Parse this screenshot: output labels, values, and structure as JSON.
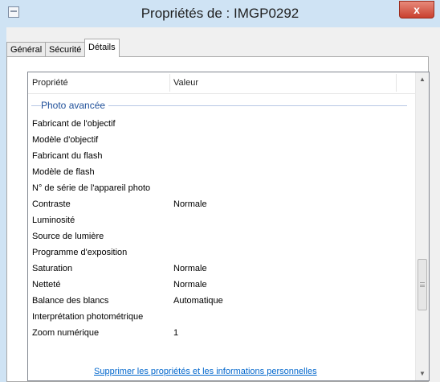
{
  "window": {
    "title": "Propriétés de : IMGP0292",
    "close_glyph": "x"
  },
  "tabs": [
    {
      "label": "Général"
    },
    {
      "label": "Sécurité"
    },
    {
      "label": "Détails"
    }
  ],
  "list": {
    "headers": {
      "property": "Propriété",
      "value": "Valeur"
    },
    "group_label": "Photo avancée",
    "rows": [
      {
        "property": "Fabricant de l'objectif",
        "value": ""
      },
      {
        "property": "Modèle d'objectif",
        "value": ""
      },
      {
        "property": "Fabricant du flash",
        "value": ""
      },
      {
        "property": "Modèle de flash",
        "value": ""
      },
      {
        "property": "N° de série de l'appareil photo",
        "value": ""
      },
      {
        "property": "Contraste",
        "value": "Normale"
      },
      {
        "property": "Luminosité",
        "value": ""
      },
      {
        "property": "Source de lumière",
        "value": ""
      },
      {
        "property": "Programme d'exposition",
        "value": ""
      },
      {
        "property": "Saturation",
        "value": "Normale"
      },
      {
        "property": "Netteté",
        "value": "Normale"
      },
      {
        "property": "Balance des blancs",
        "value": "Automatique"
      },
      {
        "property": "Interprétation photométrique",
        "value": ""
      },
      {
        "property": "Zoom numérique",
        "value": "1"
      }
    ],
    "scroll_up_glyph": "▲",
    "scroll_down_glyph": "▼"
  },
  "footer": {
    "link": "Supprimer les propriétés et les informations personnelles"
  }
}
